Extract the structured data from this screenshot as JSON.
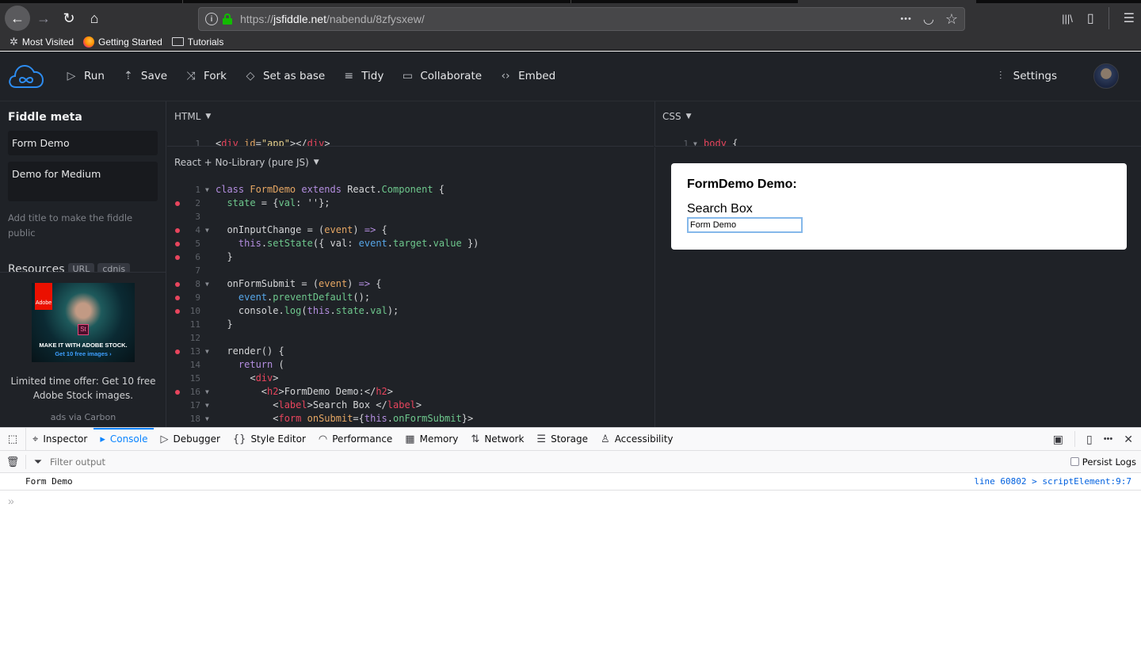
{
  "browser": {
    "url_prefix": "https://",
    "url_host": "jsfiddle.net",
    "url_path": "/nabendu/8zfysxew/",
    "icons": {
      "back": "←",
      "forward": "→",
      "reload": "↻",
      "home": "⌂",
      "more": "•••",
      "pocket": "◡",
      "star": "☆",
      "library": "|||\\",
      "sidebar": "▯",
      "menu": "☰"
    },
    "bookmarks": [
      {
        "label": "Most Visited",
        "icon": "gear-icon"
      },
      {
        "label": "Getting Started",
        "icon": "firefox-icon"
      },
      {
        "label": "Tutorials",
        "icon": "folder-icon"
      }
    ]
  },
  "toolbar": {
    "items": [
      {
        "label": "Run",
        "icon": "▷"
      },
      {
        "label": "Save",
        "icon": "⇡"
      },
      {
        "label": "Fork",
        "icon": "⤨"
      },
      {
        "label": "Set as base",
        "icon": "◇"
      },
      {
        "label": "Tidy",
        "icon": "≡"
      },
      {
        "label": "Collaborate",
        "icon": "▭"
      },
      {
        "label": "Embed",
        "icon": "‹›"
      }
    ],
    "settings_label": "Settings",
    "settings_icon": "⫶"
  },
  "sidebar": {
    "title": "Fiddle meta",
    "fiddle_title": "Form Demo",
    "fiddle_description": "Demo for Medium",
    "hint": "Add title to make the fiddle public",
    "resources_label": "Resources",
    "resource_chips": [
      "URL",
      "cdnjs"
    ],
    "ad": {
      "brand": "Adobe",
      "badge": "St",
      "headline": "MAKE IT WITH ADOBE STOCK.",
      "cta": "Get 10 free images ›",
      "text": "Limited time offer: Get 10 free Adobe Stock images.",
      "via": "ads via Carbon"
    }
  },
  "panels": {
    "html_label": "HTML",
    "css_label": "CSS",
    "js_label": "React + No-Library (pure JS)",
    "dropdown_icon": "▼"
  },
  "result": {
    "heading": "FormDemo Demo:",
    "label": "Search Box",
    "input_value": "Form Demo"
  },
  "devtools": {
    "tabs": [
      {
        "label": "Inspector",
        "icon": "⌖"
      },
      {
        "label": "Console",
        "icon": "▸",
        "active": true
      },
      {
        "label": "Debugger",
        "icon": "▷"
      },
      {
        "label": "Style Editor",
        "icon": "{}"
      },
      {
        "label": "Performance",
        "icon": "◠"
      },
      {
        "label": "Memory",
        "icon": "▦"
      },
      {
        "label": "Network",
        "icon": "⇅"
      },
      {
        "label": "Storage",
        "icon": "☰"
      },
      {
        "label": "Accessibility",
        "icon": "♙"
      }
    ],
    "filter_placeholder": "Filter output",
    "persist_logs_label": "Persist Logs",
    "log_message": "Form Demo",
    "log_location": "line 60802 > scriptElement:9:7",
    "prompt_icon": "»"
  }
}
